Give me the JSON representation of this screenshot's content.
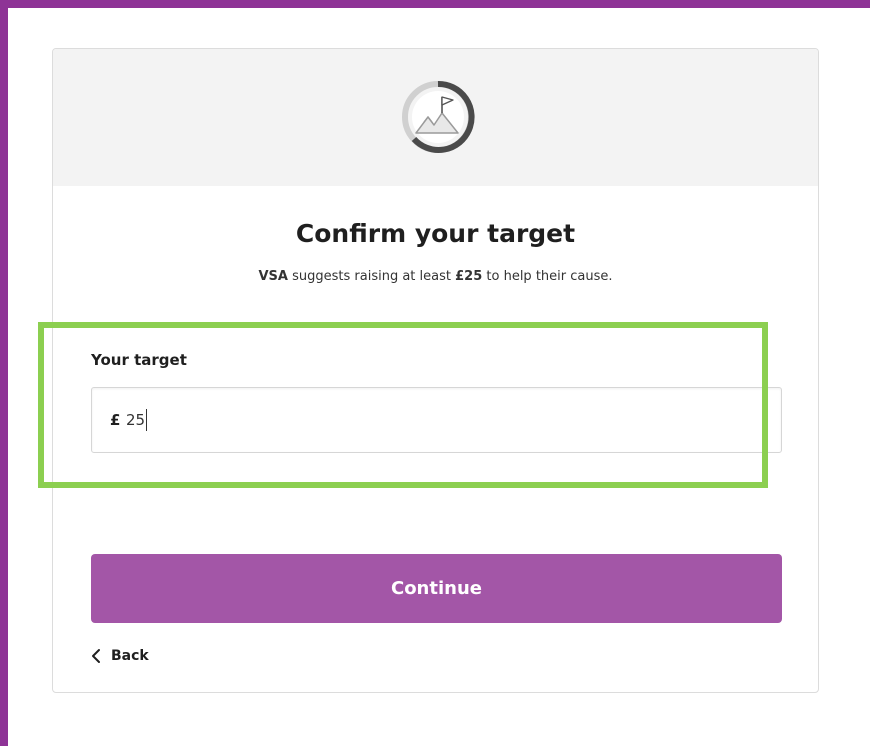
{
  "page": {
    "title": "Confirm your target",
    "subtitle_org": "VSA",
    "subtitle_pre": " suggests raising at least ",
    "subtitle_amount": "£25",
    "subtitle_post": " to help their cause."
  },
  "target": {
    "label": "Your target",
    "currency": "£",
    "value": "25"
  },
  "actions": {
    "continue_label": "Continue",
    "back_label": "Back"
  },
  "colors": {
    "frame": "#8e3396",
    "button": "#a356a7",
    "highlight": "#8ccf50",
    "header_bg": "#f3f3f3"
  },
  "icons": {
    "header": "mountain-flag-progress-icon",
    "back": "chevron-left-icon"
  }
}
